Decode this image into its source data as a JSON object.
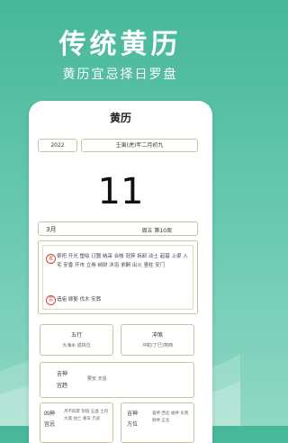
{
  "hero": {
    "title": "传统黄历",
    "subtitle": "黄历宜忌择日罗盘"
  },
  "card": {
    "title": "黄历",
    "year": "2022",
    "lunar_date": "壬寅(虎)年二月初九",
    "day": "11",
    "month": "3月",
    "weekday_week": "周五 第10周",
    "yi_label": "宜",
    "yi_text": "祭祀 开光 塑绘 订盟 纳采 合帐 冠笄 拆卸 动土 起基 上梁 入宅 安香 开市 立券 纳财 沐浴 求嗣 出火 竖柱 安门",
    "ji_label": "忌",
    "ji_text": "造庙 嫁娶 伐木 安葬",
    "wuxing_label": "五行",
    "wuxing_value": "大海水 成执位",
    "chongsha_label": "冲煞",
    "chongsha_value": "冲蛇(丁巳)煞西",
    "jishen_label1": "吉神",
    "jishen_label2": "宜趋",
    "jishen_value": "要安 天恩",
    "xiongshen_label1": "凶神",
    "xiongshen_label2": "宜忌",
    "xiongshen_value": "月不四废 刻值 五虚 土符 大煞 往亡 重日 元武",
    "fangwei_label1": "吉神",
    "fangwei_label2": "方位",
    "fangwei_value": "喜神 西北 福神 东南 财神 正北"
  }
}
